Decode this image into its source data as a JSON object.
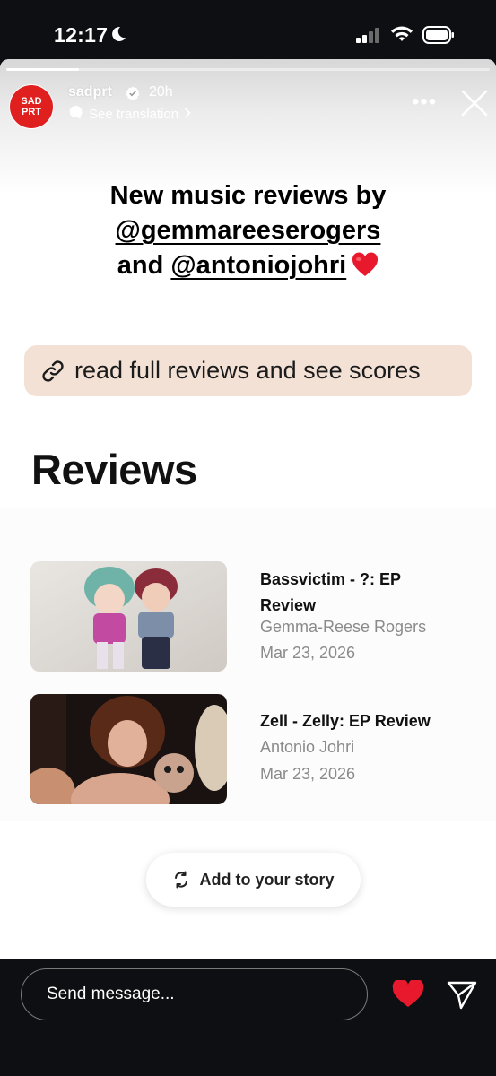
{
  "status_bar": {
    "time": "12:17"
  },
  "story": {
    "progress_fraction": 0.15,
    "account": {
      "avatar_text_line1": "SAD",
      "avatar_text_line2": "PRT",
      "username": "sadprt",
      "age": "20h",
      "see_translation": "See translation",
      "more_label": "•••"
    },
    "headline": {
      "line1": "New music reviews by",
      "mention1": "@gemmareeserogers",
      "and_text": "and",
      "mention2": "@antoniojohri"
    },
    "link_sticker": {
      "label": "read full reviews and see scores"
    },
    "reviews_heading": "Reviews",
    "reviews": [
      {
        "title": "Bassvictim - ?: EP Review",
        "author": "Gemma-Reese Rogers",
        "date": "Mar 23, 2026"
      },
      {
        "title": "Zell - Zelly: EP Review",
        "author": "Antonio Johri",
        "date": "Mar 23, 2026"
      }
    ],
    "add_to_story_label": "Add to your story"
  },
  "bottom_bar": {
    "send_placeholder": "Send message..."
  },
  "icons": {
    "moon": "moon-icon",
    "signal": "signal-icon",
    "wifi": "wifi-icon",
    "battery": "battery-icon",
    "verified": "verified-badge-icon",
    "translate": "translate-icon",
    "close": "close-icon",
    "link": "link-icon",
    "refresh": "refresh-icon",
    "heart": "heart-icon",
    "send": "send-icon"
  },
  "colors": {
    "avatar_bg": "#e0201f",
    "sticker_bg": "#f3e1d6",
    "heart": "#e8192c",
    "dark_bg": "#0e0f12"
  }
}
